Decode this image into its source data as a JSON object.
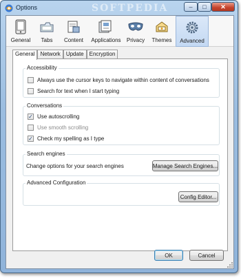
{
  "window": {
    "title": "Options",
    "watermark": "SOFTPEDIA",
    "min_glyph": "–",
    "max_glyph": "□",
    "close_glyph": "✕"
  },
  "panes": [
    {
      "label": "General",
      "icon": "general-icon",
      "selected": false
    },
    {
      "label": "Tabs",
      "icon": "tabs-icon",
      "selected": false
    },
    {
      "label": "Content",
      "icon": "content-icon",
      "selected": false
    },
    {
      "label": "Applications",
      "icon": "applications-icon",
      "selected": false
    },
    {
      "label": "Privacy",
      "icon": "privacy-icon",
      "selected": false
    },
    {
      "label": "Themes",
      "icon": "themes-icon",
      "selected": false
    },
    {
      "label": "Advanced",
      "icon": "advanced-icon",
      "selected": true
    }
  ],
  "tabs": [
    {
      "label": "General",
      "active": true
    },
    {
      "label": "Network",
      "active": false
    },
    {
      "label": "Update",
      "active": false
    },
    {
      "label": "Encryption",
      "active": false
    }
  ],
  "accessibility": {
    "heading": "Accessibility",
    "options": [
      {
        "label": "Always use the cursor keys to navigate within content of conversations",
        "checked": false
      },
      {
        "label": "Search for text when I start typing",
        "checked": false
      }
    ]
  },
  "conversations": {
    "heading": "Conversations",
    "options": [
      {
        "label": "Use autoscrolling",
        "checked": true,
        "disabled": false
      },
      {
        "label": "Use smooth scrolling",
        "checked": false,
        "disabled": true
      },
      {
        "label": "Check my spelling as I type",
        "checked": true,
        "disabled": false
      }
    ]
  },
  "search_engines": {
    "heading": "Search engines",
    "description": "Change options for your search engines",
    "button": "Manage Search Engines..."
  },
  "advanced_config": {
    "heading": "Advanced Configuration",
    "button": "Config Editor..."
  },
  "footer": {
    "ok": "OK",
    "cancel": "Cancel"
  },
  "colors": {
    "selected_pane": "#c4d9f3",
    "check_mark": "#21426f"
  }
}
